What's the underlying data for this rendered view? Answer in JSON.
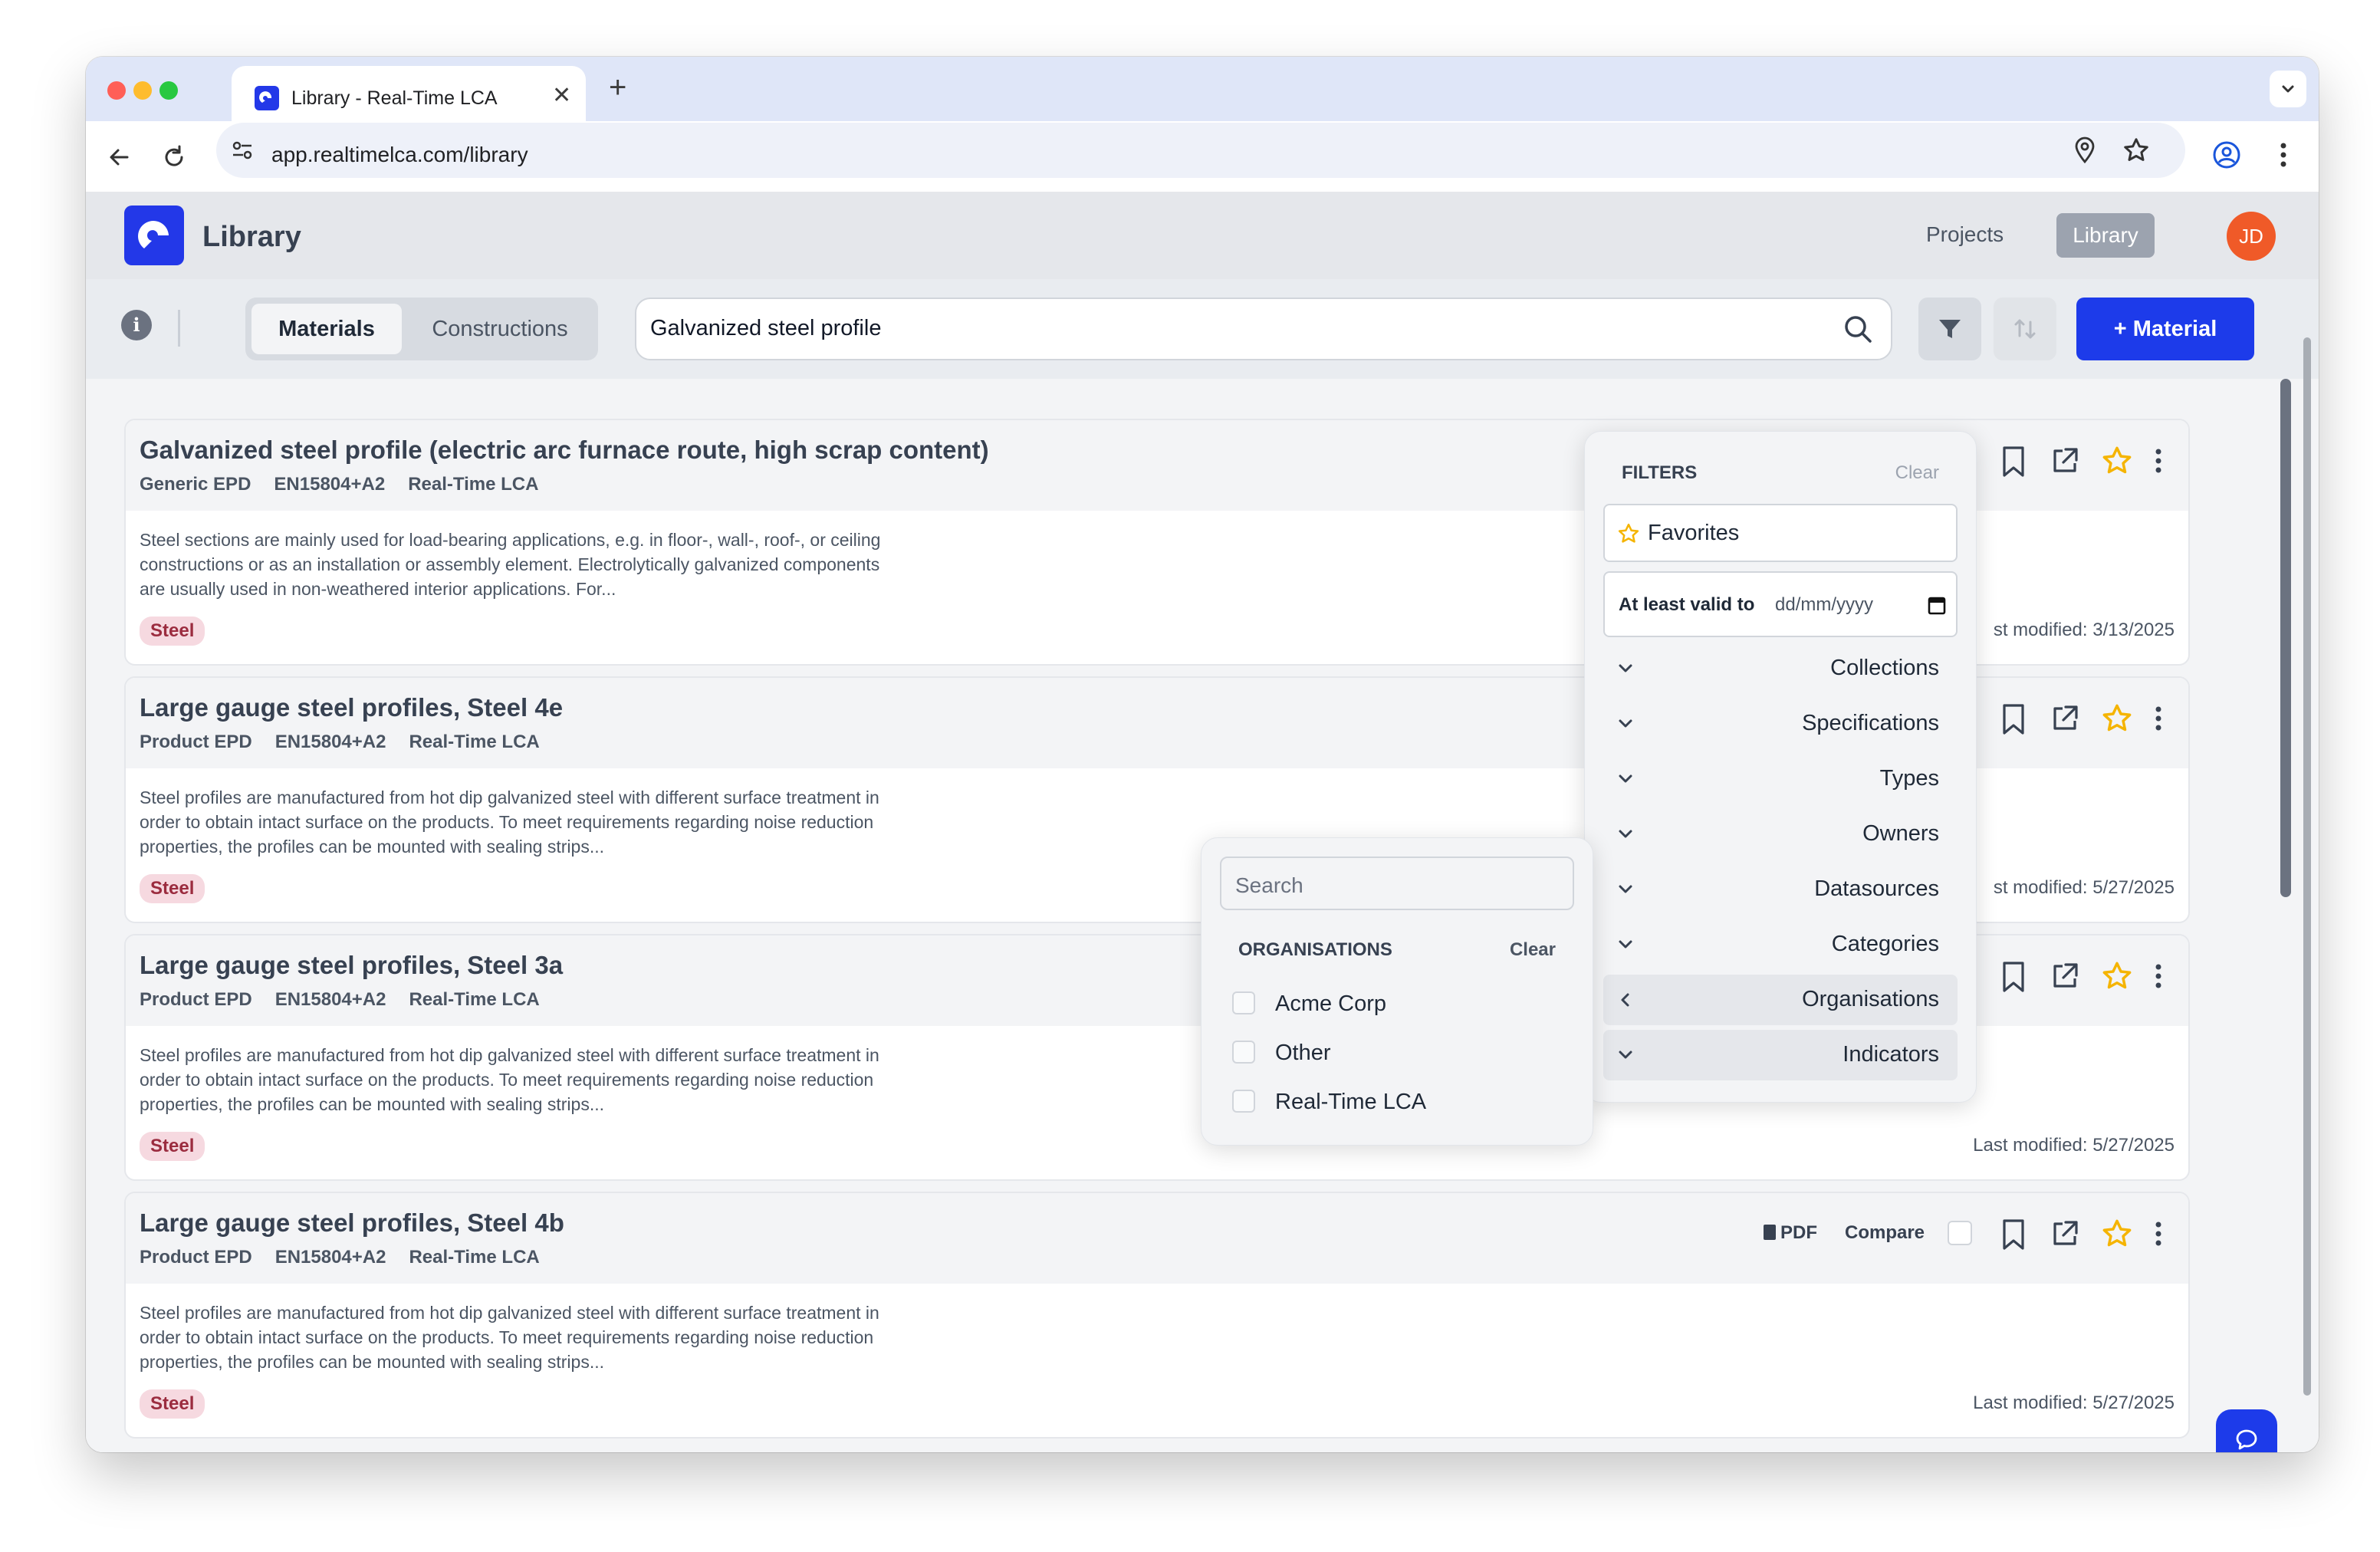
{
  "browser": {
    "tab_title": "Library - Real-Time LCA",
    "url": "app.realtimelca.com/library"
  },
  "app": {
    "title": "Library",
    "nav": {
      "projects": "Projects",
      "library": "Library"
    },
    "avatar_initials": "JD"
  },
  "controls": {
    "tabs": {
      "materials": "Materials",
      "constructions": "Constructions"
    },
    "search_value": "Galvanized steel profile",
    "add_button": "+ Material"
  },
  "cards": [
    {
      "title": "Galvanized steel profile (electric arc furnace route, high scrap content)",
      "type": "Generic EPD",
      "standard": "EN15804+A2",
      "source": "Real-Time LCA",
      "description": "Steel sections are mainly used for load-bearing applications, e.g. in floor-, wall-, roof-, or ceiling constructions or as an installation or assembly element. Electrolytically galvanized components are usually used in non-weathered interior applications. For...",
      "tag": "Steel",
      "modified": "st modified: 3/13/2025"
    },
    {
      "title": "Large gauge steel profiles, Steel 4e",
      "type": "Product EPD",
      "standard": "EN15804+A2",
      "source": "Real-Time LCA",
      "description": "Steel profiles are manufactured from hot dip galvanized steel with different surface treatment in order to obtain intact surface on the products. To meet requirements regarding noise reduction properties, the profiles can be mounted with sealing strips...",
      "tag": "Steel",
      "modified": "st modified: 5/27/2025"
    },
    {
      "title": "Large gauge steel profiles, Steel 3a",
      "type": "Product EPD",
      "standard": "EN15804+A2",
      "source": "Real-Time LCA",
      "description": "Steel profiles are manufactured from hot dip galvanized steel with different surface treatment in order to obtain intact surface on the products. To meet requirements regarding noise reduction properties, the profiles can be mounted with sealing strips...",
      "tag": "Steel",
      "modified": "Last modified: 5/27/2025"
    },
    {
      "title": "Large gauge steel profiles, Steel 4b",
      "type": "Product EPD",
      "standard": "EN15804+A2",
      "source": "Real-Time LCA",
      "description": "Steel profiles are manufactured from hot dip galvanized steel with different surface treatment in order to obtain intact surface on the products. To meet requirements regarding noise reduction properties, the profiles can be mounted with sealing strips...",
      "tag": "Steel",
      "modified": "Last modified: 5/27/2025",
      "pdf_label": "PDF",
      "compare_label": "Compare"
    }
  ],
  "filters": {
    "title": "FILTERS",
    "clear": "Clear",
    "favorites": "Favorites",
    "date_label": "At least valid to",
    "date_placeholder": "dd/mm/yyyy",
    "groups": [
      "Collections",
      "Specifications",
      "Types",
      "Owners",
      "Datasources",
      "Categories",
      "Organisations",
      "Indicators"
    ]
  },
  "organisations": {
    "search_placeholder": "Search",
    "title": "ORGANISATIONS",
    "clear": "Clear",
    "items": [
      "Acme Corp",
      "Other",
      "Real-Time LCA"
    ]
  },
  "colors": {
    "brand_blue": "#1d3bea",
    "star": "#f5b400",
    "tag_bg": "#f6d9e0",
    "avatar": "#f05a28"
  }
}
